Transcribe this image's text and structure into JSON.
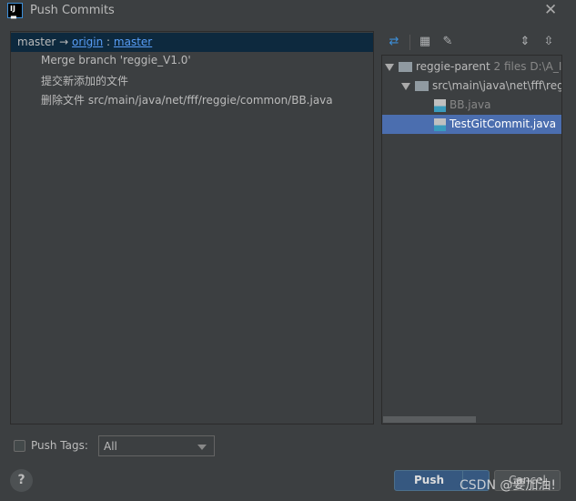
{
  "window": {
    "title": "Push Commits",
    "close_icon": "close-icon"
  },
  "commits": {
    "branch": {
      "local": "master",
      "arrow": "→",
      "remote": "origin",
      "sep": ":",
      "remote_branch": "master"
    },
    "items": [
      "Merge branch 'reggie_V1.0'",
      "提交新添加的文件",
      "删除文件 src/main/java/net/fff/reggie/common/BB.java"
    ]
  },
  "toolbar": {
    "icons": [
      "compare-arrows-icon",
      "group-by-icon",
      "edit-icon",
      "expand-all-icon",
      "collapse-all-icon"
    ]
  },
  "tree": {
    "root": {
      "name": "reggie-parent",
      "count": "2 files",
      "path": "D:\\A_I"
    },
    "folder": "src\\main\\java\\net\\fff\\reg",
    "files": [
      {
        "name": "BB.java",
        "deleted": true
      },
      {
        "name": "TestGitCommit.java",
        "selected": true
      }
    ]
  },
  "footer": {
    "push_tags_label": "Push Tags:",
    "push_tags_checked": false,
    "tags_value": "All",
    "push_label": "Push",
    "cancel_label": "Cancel",
    "help": "?"
  },
  "watermark": "CSDN @要加油!",
  "colors": {
    "background": "#3c3f41",
    "branch_header": "#0d293e",
    "selection": "#4b6eaf",
    "push_button": "#365880",
    "link": "#589df6"
  }
}
